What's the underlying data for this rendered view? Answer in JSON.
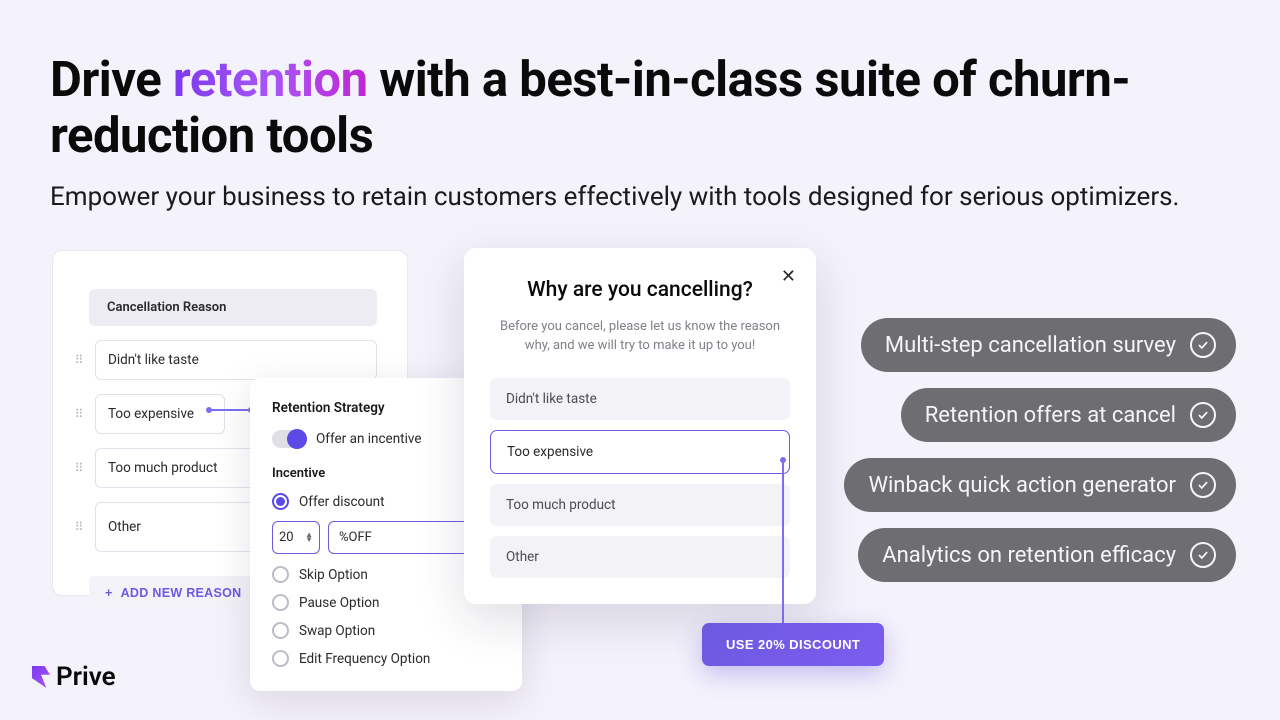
{
  "headline": {
    "part1": "Drive ",
    "accent": "retention",
    "part2": " with a best-in-class suite of churn-reduction tools"
  },
  "subhead": "Empower your business to retain customers effectively with tools designed for serious optimizers.",
  "admin": {
    "header": "Cancellation Reason",
    "reasons": [
      "Didn't like taste",
      "Too expensive",
      "Too much product",
      "Other"
    ],
    "add_label": "ADD NEW REASON"
  },
  "strategy": {
    "title": "Retention Strategy",
    "toggle_label": "Offer an incentive",
    "incentive_title": "Incentive",
    "options": [
      "Offer discount",
      "Skip Option",
      "Pause Option",
      "Swap Option",
      "Edit Frequency Option"
    ],
    "discount_value": "20",
    "discount_unit": "%OFF"
  },
  "modal": {
    "title": "Why are you cancelling?",
    "desc": "Before you cancel, please let us know the reason why, and we will try to make it up to you!",
    "options": [
      "Didn't like taste",
      "Too expensive",
      "Too much product",
      "Other"
    ]
  },
  "cta": "USE 20% DISCOUNT",
  "pills": [
    "Multi-step cancellation survey",
    "Retention offers at cancel",
    "Winback quick action generator",
    "Analytics on retention efficacy"
  ],
  "brand": "Prive"
}
